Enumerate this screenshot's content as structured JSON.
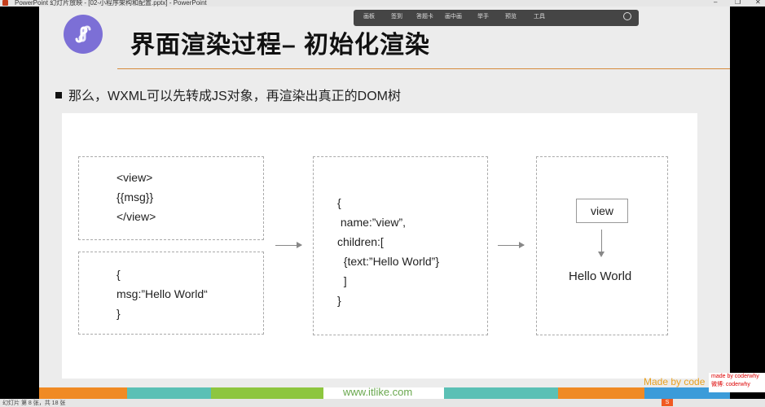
{
  "window": {
    "title": "PowerPoint 幻灯片放映 - [02-小程序架构和配置.pptx] - PowerPoint",
    "minimize": "–",
    "restore": "❐",
    "close": "✕"
  },
  "toolbar": {
    "items": [
      "画板",
      "签到",
      "答题卡",
      "画中画",
      "举手",
      "预览",
      "工具"
    ]
  },
  "slide": {
    "title": "界面渲染过程– 初始化渲染",
    "bullet": "那么，WXML可以先转成JS对象，再渲染出真正的DOM树",
    "wxml_code": [
      "<view>",
      "{{msg}}",
      "</view>"
    ],
    "data_code": [
      "{",
      "msg:”Hello World“",
      "}"
    ],
    "js_object_code": [
      "{",
      " name:”view”,",
      "children:[",
      "  {text:”Hello World”}",
      "  ]",
      "}"
    ],
    "dom_node": "view",
    "dom_text": "Hello World",
    "footer_site": "www.itlike.com",
    "made_by": "Made by code",
    "footer_colors": [
      "#f08a24",
      "#5bc0b5",
      "#8dc63f",
      "#ffffff",
      "#5bc0b5",
      "#f08a24",
      "#3b9bd9"
    ]
  },
  "watermark": {
    "line1": "made by coderwhy",
    "line2": "微博: coderwhy"
  },
  "statusbar": {
    "text": "幻灯片 第 8 张，共 18 张",
    "ime": "S"
  }
}
